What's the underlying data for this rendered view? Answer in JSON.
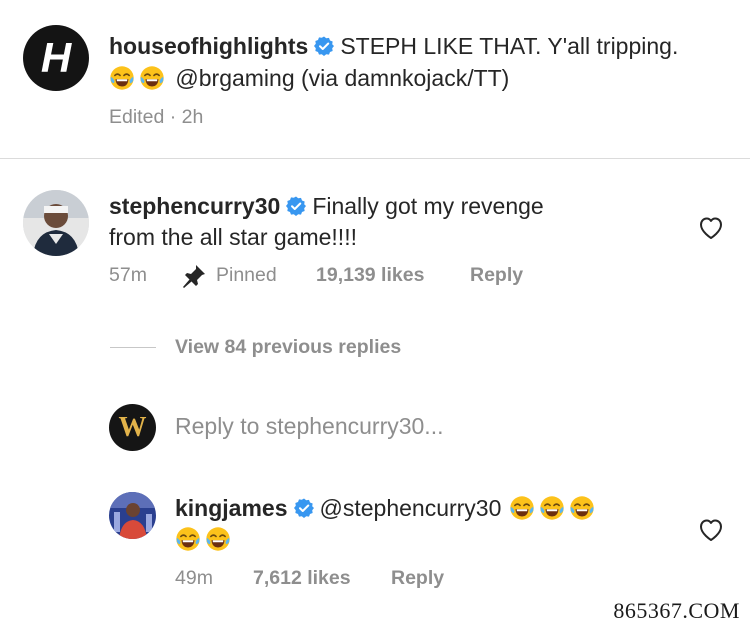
{
  "post": {
    "username": "houseofhighlights",
    "caption_line1": "STEPH LIKE THAT. Y'all tripping.",
    "mention": "@brgaming",
    "caption_rest": "(via damnkojack/TT)",
    "meta": "Edited · 2h",
    "avatar_letter": "H"
  },
  "comment1": {
    "username": "stephencurry30",
    "text_line1": "Finally got my revenge",
    "text_line2": "from the all star game!!!!",
    "time": "57m",
    "pinned_label": "Pinned",
    "likes": "19,139 likes",
    "reply_label": "Reply"
  },
  "replies": {
    "view_label": "View 84 previous replies"
  },
  "reply_box": {
    "placeholder": "Reply to stephencurry30...",
    "avatar_letter": "W"
  },
  "comment2": {
    "username": "kingjames",
    "mention": "@stephencurry30",
    "time": "49m",
    "likes": "7,612 likes",
    "reply_label": "Reply"
  },
  "watermark": "865367.COM",
  "icons": {
    "verified": "verified-badge-icon",
    "heart": "heart-outline-icon",
    "pin": "pin-icon",
    "emoji": "laughing-tears-emoji"
  },
  "colors": {
    "verified": "#3897f0",
    "meta": "#8e8e8e",
    "text": "#262626"
  }
}
